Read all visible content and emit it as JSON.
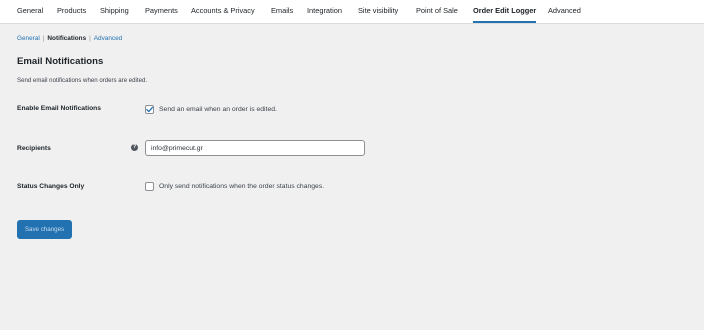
{
  "tabs": [
    {
      "label": "General",
      "active": false
    },
    {
      "label": "Products",
      "active": false
    },
    {
      "label": "Shipping",
      "active": false
    },
    {
      "label": "Payments",
      "active": false
    },
    {
      "label": "Accounts & Privacy",
      "active": false
    },
    {
      "label": "Emails",
      "active": false
    },
    {
      "label": "Integration",
      "active": false
    },
    {
      "label": "Site visibility",
      "active": false
    },
    {
      "label": "Point of Sale",
      "active": false
    },
    {
      "label": "Order Edit Logger",
      "active": true
    },
    {
      "label": "Advanced",
      "active": false
    }
  ],
  "subnav": {
    "general": "General",
    "notifications": "Notifications",
    "advanced": "Advanced",
    "separator": "|"
  },
  "section": {
    "title": "Email Notifications",
    "description": "Send email notifications when orders are edited."
  },
  "fields": {
    "enable": {
      "label": "Enable Email Notifications",
      "checkbox_text": "Send an email when an order is edited.",
      "checked": true
    },
    "recipients": {
      "label": "Recipients",
      "help_icon": "question-circle-icon",
      "help_glyph": "?",
      "value": "info@primecut.gr"
    },
    "status_only": {
      "label": "Status Changes Only",
      "checkbox_text": "Only send notifications when the order status changes.",
      "checked": false
    }
  },
  "save_button": "Save changes",
  "colors": {
    "accent": "#2271b1",
    "background": "#f0f0f1",
    "tab_bar": "#ffffff"
  }
}
